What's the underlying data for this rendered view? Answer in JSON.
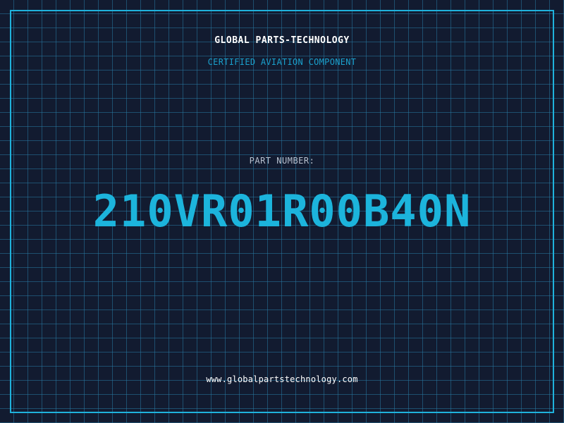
{
  "header": {
    "company": "GLOBAL PARTS-TECHNOLOGY",
    "subtitle": "CERTIFIED AVIATION COMPONENT"
  },
  "main": {
    "label": "PART NUMBER:",
    "part_number": "210VR01R00B40N"
  },
  "footer": {
    "website": "www.globalpartstechnology.com"
  },
  "colors": {
    "background": "#121b30",
    "accent": "#1fb2dc",
    "grid": "#28789f"
  }
}
